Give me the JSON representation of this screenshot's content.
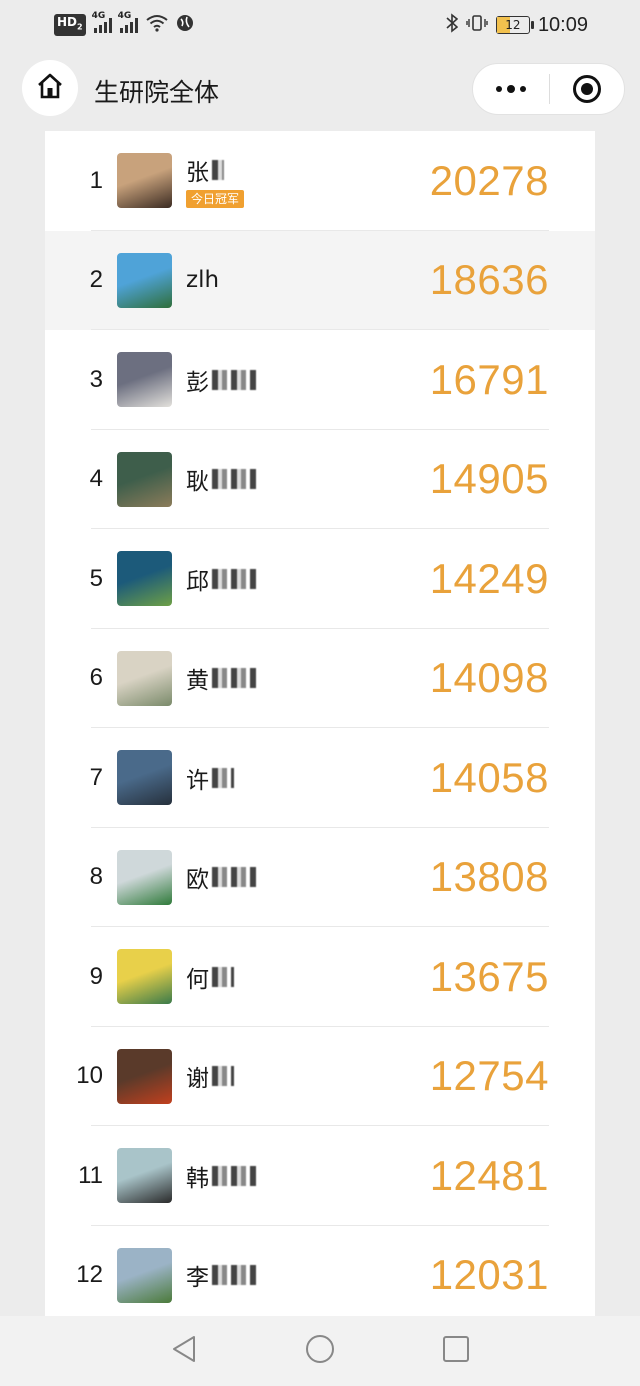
{
  "status_bar": {
    "hd_label": "HD",
    "hd_sub": "2",
    "sim1": "4G",
    "sim2": "4G",
    "battery": "12",
    "time": "10:09"
  },
  "nav": {
    "title": "生研院全体"
  },
  "ranking": [
    {
      "rank": "1",
      "name": "张",
      "blur_w": 12,
      "badge": "今日冠军",
      "steps": "20278",
      "avatar_colors": [
        "#c8a27c",
        "#3b2b22"
      ],
      "highlight": false
    },
    {
      "rank": "2",
      "name": "zlh",
      "blur_w": 0,
      "badge": "",
      "steps": "18636",
      "avatar_colors": [
        "#4fa3d8",
        "#2f6e3a"
      ],
      "highlight": true
    },
    {
      "rank": "3",
      "name": "彭",
      "blur_w": 44,
      "badge": "",
      "steps": "16791",
      "avatar_colors": [
        "#6c6f80",
        "#e3e1dc"
      ],
      "highlight": false
    },
    {
      "rank": "4",
      "name": "耿",
      "blur_w": 44,
      "badge": "",
      "steps": "14905",
      "avatar_colors": [
        "#3e5e4b",
        "#8c7c5a"
      ],
      "highlight": false
    },
    {
      "rank": "5",
      "name": "邱",
      "blur_w": 44,
      "badge": "",
      "steps": "14249",
      "avatar_colors": [
        "#1c5a7a",
        "#6ea046"
      ],
      "highlight": false
    },
    {
      "rank": "6",
      "name": "黄",
      "blur_w": 44,
      "badge": "",
      "steps": "14098",
      "avatar_colors": [
        "#d9d3c4",
        "#7a8a6a"
      ],
      "highlight": false
    },
    {
      "rank": "7",
      "name": "许",
      "blur_w": 22,
      "badge": "",
      "steps": "14058",
      "avatar_colors": [
        "#4a6a8a",
        "#26303c"
      ],
      "highlight": false
    },
    {
      "rank": "8",
      "name": "欧",
      "blur_w": 44,
      "badge": "",
      "steps": "13808",
      "avatar_colors": [
        "#cfd8da",
        "#2f7a3a"
      ],
      "highlight": false
    },
    {
      "rank": "9",
      "name": "何",
      "blur_w": 22,
      "badge": "",
      "steps": "13675",
      "avatar_colors": [
        "#e8d04a",
        "#3a7a4a"
      ],
      "highlight": false
    },
    {
      "rank": "10",
      "name": "谢",
      "blur_w": 22,
      "badge": "",
      "steps": "12754",
      "avatar_colors": [
        "#5a3a2a",
        "#c2401e"
      ],
      "highlight": false
    },
    {
      "rank": "11",
      "name": "韩",
      "blur_w": 44,
      "badge": "",
      "steps": "12481",
      "avatar_colors": [
        "#a9c4c9",
        "#2a2a2a"
      ],
      "highlight": false
    },
    {
      "rank": "12",
      "name": "李",
      "blur_w": 44,
      "badge": "",
      "steps": "12031",
      "avatar_colors": [
        "#9bb3c6",
        "#4b7a3a"
      ],
      "highlight": false
    }
  ],
  "colors": {
    "steps": "#e9a23b",
    "badge": "#f0a030",
    "highlight_row": "#f4f4f4"
  },
  "icons": {
    "home": "home-icon",
    "more": "more-dots-icon",
    "close": "target-circle-icon",
    "back": "triangle-back-icon",
    "home_sys": "circle-home-icon",
    "recents": "square-recents-icon"
  }
}
